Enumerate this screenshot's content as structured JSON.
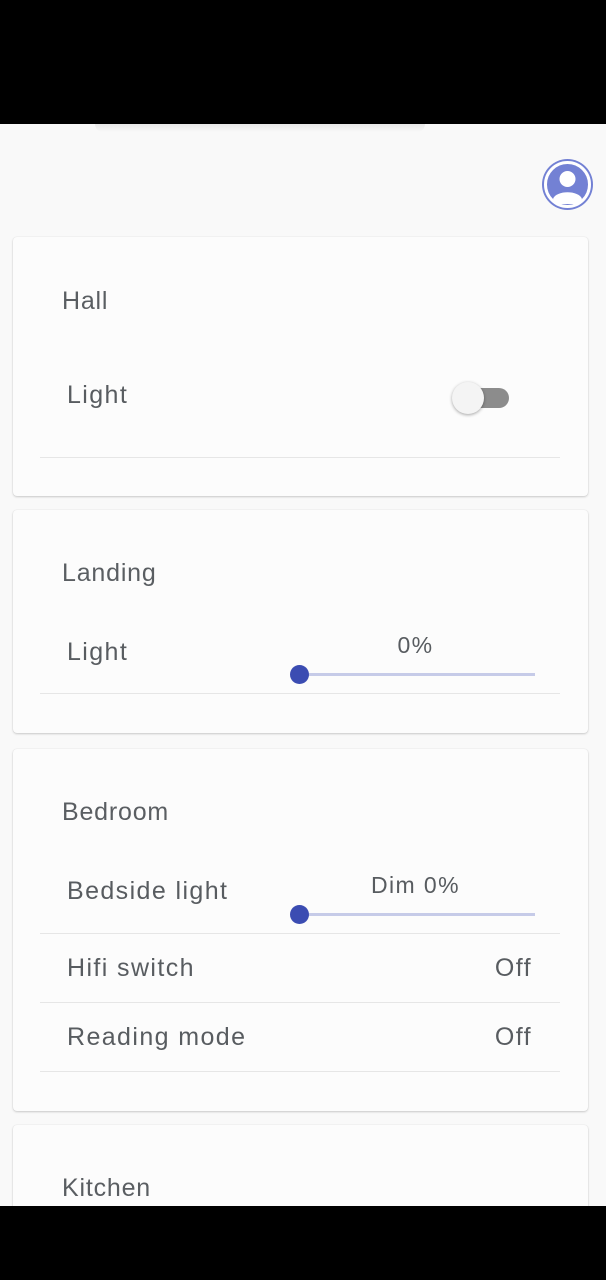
{
  "header": {
    "avatar_icon": "account-circle-icon"
  },
  "colors": {
    "accent": "#3b4cb2",
    "avatar": "#7381d4",
    "toggle_off": "#8c8c8c"
  },
  "cards": {
    "hall": {
      "title": "Hall",
      "rows": [
        {
          "label": "Light",
          "type": "toggle",
          "on": false
        }
      ]
    },
    "landing": {
      "title": "Landing",
      "rows": [
        {
          "label": "Light",
          "type": "slider",
          "value_text": "0%",
          "level": 0
        }
      ]
    },
    "bedroom": {
      "title": "Bedroom",
      "rows": [
        {
          "label": "Bedside light",
          "type": "slider",
          "value_text": "Dim 0%",
          "level": 0
        },
        {
          "label": "Hifi switch",
          "type": "text",
          "value_text": "Off"
        },
        {
          "label": "Reading mode",
          "type": "text",
          "value_text": "Off"
        }
      ]
    },
    "kitchen": {
      "title": "Kitchen"
    }
  }
}
